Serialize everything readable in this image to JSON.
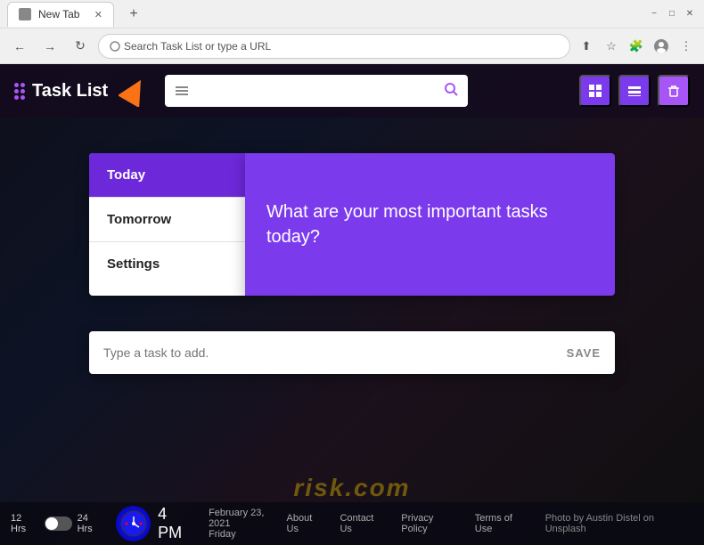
{
  "browser": {
    "title_bar": {
      "tab_label": "New Tab",
      "new_tab_btn": "+",
      "minimize_btn": "−",
      "maximize_btn": "□",
      "close_btn": "✕"
    },
    "nav_bar": {
      "back_btn": "←",
      "forward_btn": "→",
      "refresh_btn": "↻",
      "address_placeholder": "Search Task List or type a URL",
      "share_icon": "⬆",
      "star_icon": "☆",
      "puzzle_icon": "🧩",
      "profile_icon": "👤",
      "menu_icon": "⋮"
    }
  },
  "app": {
    "logo_text": "Task List",
    "header": {
      "search_placeholder": "",
      "search_icon": "🔍",
      "list_icon": "☰",
      "grid_btn": "⊞",
      "layout_btn": "⊟",
      "delete_btn": "🗑"
    },
    "sidebar": {
      "items": [
        {
          "label": "Today",
          "active": true
        },
        {
          "label": "Tomorrow",
          "active": false
        },
        {
          "label": "Settings",
          "active": false
        }
      ]
    },
    "task_panel": {
      "prompt": "What are your most important tasks today?"
    },
    "add_task": {
      "placeholder": "Type a task to add.",
      "save_btn": "SAVE"
    }
  },
  "bottom_bar": {
    "time_12h": "12 Hrs",
    "time_24h": "24 Hrs",
    "time": "4 PM",
    "date": "February 23, 2021",
    "day": "Friday",
    "links": [
      "About Us",
      "Contact Us",
      "Privacy Policy",
      "Terms of Use"
    ],
    "photo_credit": "Photo by Austin Distel on Unsplash"
  },
  "watermark": {
    "text": "risk.com"
  }
}
